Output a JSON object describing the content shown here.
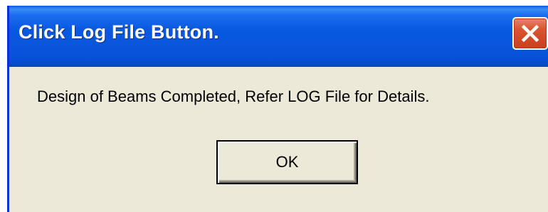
{
  "dialog": {
    "title": "Click Log File Button.",
    "message": "Design of Beams Completed, Refer LOG File for Details.",
    "ok_label": "OK"
  },
  "icons": {
    "close": "close-icon"
  },
  "colors": {
    "titlebar": "#0858e0",
    "body": "#ece9d8",
    "close_button": "#d9562f"
  }
}
